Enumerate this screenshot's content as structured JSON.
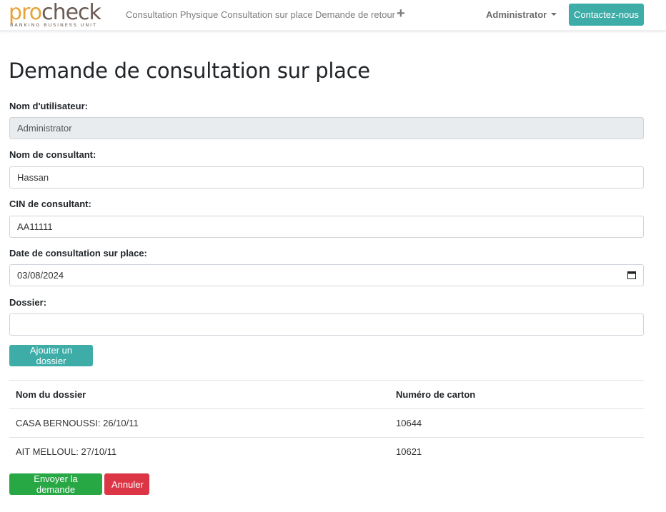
{
  "brand": {
    "logo_word_a": "pro",
    "logo_word_b": "check",
    "logo_tagline": "BANKING BUSINESS UNIT",
    "colors": {
      "orange": "#e8a33a",
      "brown": "#6b5b53"
    }
  },
  "nav": {
    "links": [
      "Consultation Physique",
      "Consultation sur place",
      "Demande de retour"
    ],
    "plus_icon": "+",
    "user_menu": "Administrator",
    "contact_button": "Contactez-nous"
  },
  "page": {
    "title": "Demande de consultation sur place"
  },
  "form": {
    "username_label": "Nom d'utilisateur:",
    "username_value": "Administrator",
    "consultant_name_label": "Nom de consultant:",
    "consultant_name_value": "Hassan",
    "consultant_cin_label": "CIN de consultant:",
    "consultant_cin_value": "AA11111",
    "date_label": "Date de consultation sur place:",
    "date_value": "03/08/2024",
    "folder_label": "Dossier:",
    "folder_value": "",
    "add_folder_button": "Ajouter un dossier"
  },
  "table": {
    "headers": [
      "Nom du dossier",
      "Numéro de carton"
    ],
    "rows": [
      [
        "CASA BERNOUSSI: 26/10/11",
        "10644"
      ],
      [
        "AIT MELLOUL: 27/10/11",
        "10621"
      ]
    ]
  },
  "actions": {
    "submit_button": "Envoyer la demande",
    "cancel_button": "Annuler"
  },
  "colors": {
    "teal": "#3eada8",
    "success": "#28a745",
    "danger": "#dc3545",
    "readonly_bg": "#e9ecef"
  }
}
